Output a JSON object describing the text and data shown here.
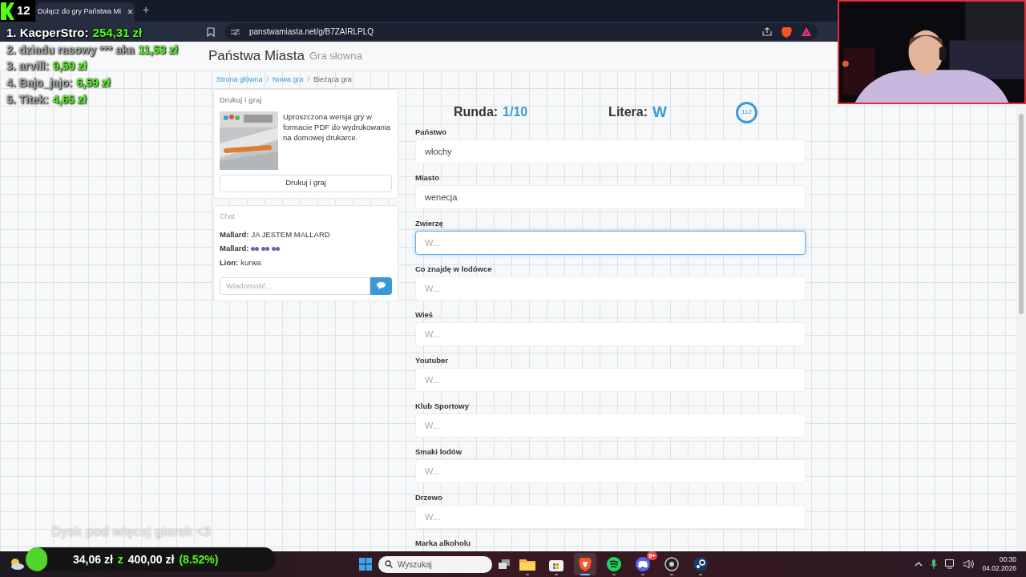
{
  "stream_logo": {
    "count": "12"
  },
  "browser": {
    "tab": {
      "title": "Dołącz do gry Państwa Mi",
      "close": "×"
    },
    "new_tab": "+",
    "url": "panstwamiasta.net/g/B7ZAIRLPLQ"
  },
  "site": {
    "title": "Państwa Miasta",
    "subtitle": "Gra słowna"
  },
  "breadcrumbs": {
    "separator": "/",
    "items": [
      {
        "label": "Strona główna",
        "link": true
      },
      {
        "label": "Nowa gra",
        "link": true
      },
      {
        "label": "Bieżąca gra",
        "link": false
      }
    ]
  },
  "print_card": {
    "heading": "Drukuj i graj",
    "description": "Uproszczona wersja gry w formacie PDF do wydrukowania na domowej drukarce.",
    "button": "Drukuj i graj"
  },
  "chat": {
    "heading": "Chat",
    "messages": [
      {
        "kind": "text",
        "author": "Mallard:",
        "text": "JA JESTEM MALLARD"
      },
      {
        "kind": "emotes",
        "author": "Mallard:"
      },
      {
        "kind": "text",
        "author": "Lion:",
        "text": "kurwa"
      }
    ],
    "placeholder": "Wiadomość..."
  },
  "round": {
    "label": "Runda:",
    "value": "1/10",
    "letter_label": "Litera:",
    "letter": "W",
    "timer": "112"
  },
  "fields": [
    {
      "label": "Państwo",
      "value": "włochy",
      "focused": false
    },
    {
      "label": "Miasto",
      "value": "wenecja",
      "focused": false
    },
    {
      "label": "Zwierzę",
      "placeholder": "W...",
      "focused": true
    },
    {
      "label": "Co znajdę w lodówce",
      "placeholder": "W...",
      "focused": false
    },
    {
      "label": "Wieś",
      "placeholder": "W...",
      "focused": false
    },
    {
      "label": "Youtuber",
      "placeholder": "W...",
      "focused": false
    },
    {
      "label": "Klub Sportowy",
      "placeholder": "W...",
      "focused": false
    },
    {
      "label": "Smaki lodów",
      "placeholder": "W...",
      "focused": false
    },
    {
      "label": "Drzewo",
      "placeholder": "W...",
      "focused": false
    }
  ],
  "next_label": "Marka alkoholu",
  "leaderboard": [
    {
      "name": "1. KacperStro:",
      "amount": "254,31 zł"
    },
    {
      "name": "2. dziadu rasowy *** aka",
      "amount": "11,53 zł"
    },
    {
      "name": "3. arvill:",
      "amount": "9,50 zł"
    },
    {
      "name": "4. Bajo_jajo:",
      "amount": "6,59 zł"
    },
    {
      "name": "5. Titek:",
      "amount": "4,65 zł"
    }
  ],
  "caption": "Dysk pod więcej gierek <3",
  "goal": {
    "current": "34,06 zł",
    "separator": "z",
    "target": "400,00 zł",
    "percent": "(8.52%)",
    "level": 0.0852
  },
  "taskbar": {
    "search": "Wyszukaj",
    "apps": [
      {
        "kind": "files",
        "active": false
      },
      {
        "kind": "store",
        "active": false
      },
      {
        "kind": "browser",
        "active": true
      },
      {
        "kind": "music",
        "active": false
      },
      {
        "kind": "chat",
        "active": false,
        "badge": "9+"
      },
      {
        "kind": "record",
        "active": false
      },
      {
        "kind": "games",
        "active": false
      }
    ],
    "time": "00:30",
    "date": "04.02.2026"
  }
}
